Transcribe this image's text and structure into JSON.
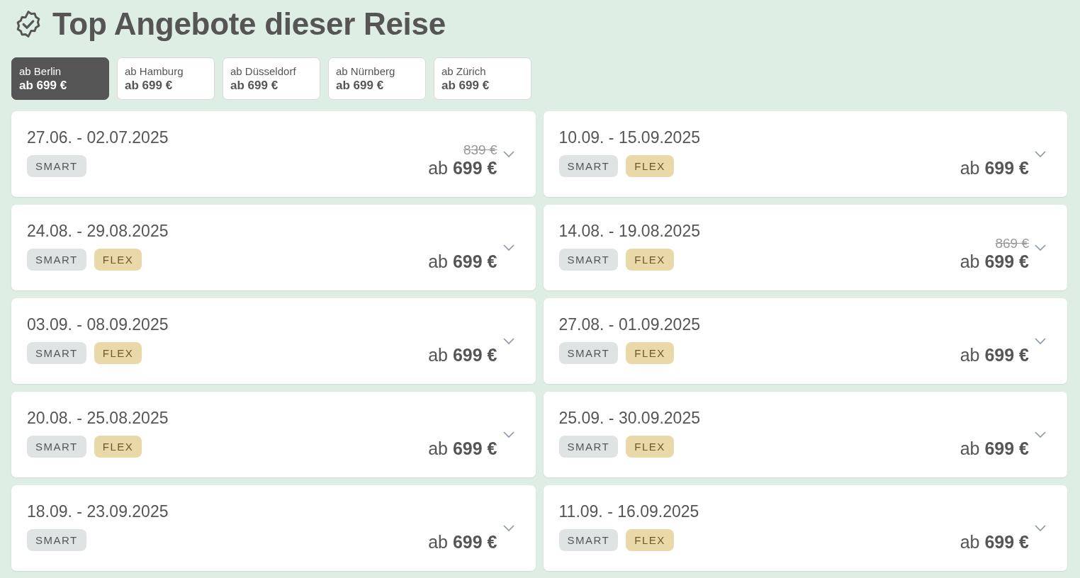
{
  "title": "Top Angebote dieser Reise",
  "tabs": [
    {
      "label": "ab Berlin",
      "price": "ab 699 €",
      "selected": true
    },
    {
      "label": "ab Hamburg",
      "price": "ab 699 €",
      "selected": false
    },
    {
      "label": "ab Düsseldorf",
      "price": "ab 699 €",
      "selected": false
    },
    {
      "label": "ab Nürnberg",
      "price": "ab 699 €",
      "selected": false
    },
    {
      "label": "ab Zürich",
      "price": "ab 699 €",
      "selected": false
    }
  ],
  "offers": [
    {
      "dates": "27.06. - 02.07.2025",
      "tags": [
        {
          "kind": "smart",
          "label": "SMART"
        }
      ],
      "old_price": "839 €",
      "price": "ab **699 €**",
      "expanded": false
    },
    {
      "dates": "10.09. - 15.09.2025",
      "tags": [
        {
          "kind": "smart",
          "label": "SMART"
        },
        {
          "kind": "flex",
          "label": "FLEX"
        }
      ],
      "price": "ab **699 €**",
      "expanded": false
    },
    {
      "dates": "24.08. - 29.08.2025",
      "tags": [
        {
          "kind": "smart",
          "label": "SMART"
        },
        {
          "kind": "flex",
          "label": "FLEX"
        }
      ],
      "price": "ab **699 €**",
      "expanded": false
    },
    {
      "dates": "14.08. - 19.08.2025",
      "tags": [
        {
          "kind": "smart",
          "label": "SMART"
        },
        {
          "kind": "flex",
          "label": "FLEX"
        }
      ],
      "old_price": "869 €",
      "price": "ab **699 €**",
      "expanded": false
    },
    {
      "dates": "03.09. - 08.09.2025",
      "tags": [
        {
          "kind": "smart",
          "label": "SMART"
        },
        {
          "kind": "flex",
          "label": "FLEX"
        }
      ],
      "price": "ab **699 €**",
      "expanded": false
    },
    {
      "dates": "27.08. - 01.09.2025",
      "tags": [
        {
          "kind": "smart",
          "label": "SMART"
        },
        {
          "kind": "flex",
          "label": "FLEX"
        }
      ],
      "price": "ab **699 €**",
      "expanded": false
    },
    {
      "dates": "20.08. - 25.08.2025",
      "tags": [
        {
          "kind": "smart",
          "label": "SMART"
        },
        {
          "kind": "flex",
          "label": "FLEX"
        }
      ],
      "price": "ab **699 €**",
      "expanded": false
    },
    {
      "dates": "25.09. - 30.09.2025",
      "tags": [
        {
          "kind": "smart",
          "label": "SMART"
        },
        {
          "kind": "flex",
          "label": "FLEX"
        }
      ],
      "price": "ab **699 €**",
      "expanded": false
    },
    {
      "dates": "18.09. - 23.09.2025",
      "tags": [
        {
          "kind": "smart",
          "label": "SMART"
        }
      ],
      "price": "ab **699 €**",
      "expanded": false
    },
    {
      "dates": "11.09. - 16.09.2025",
      "tags": [
        {
          "kind": "smart",
          "label": "SMART"
        },
        {
          "kind": "flex",
          "label": "FLEX"
        }
      ],
      "price": "ab **699 €**",
      "expanded": false
    }
  ]
}
